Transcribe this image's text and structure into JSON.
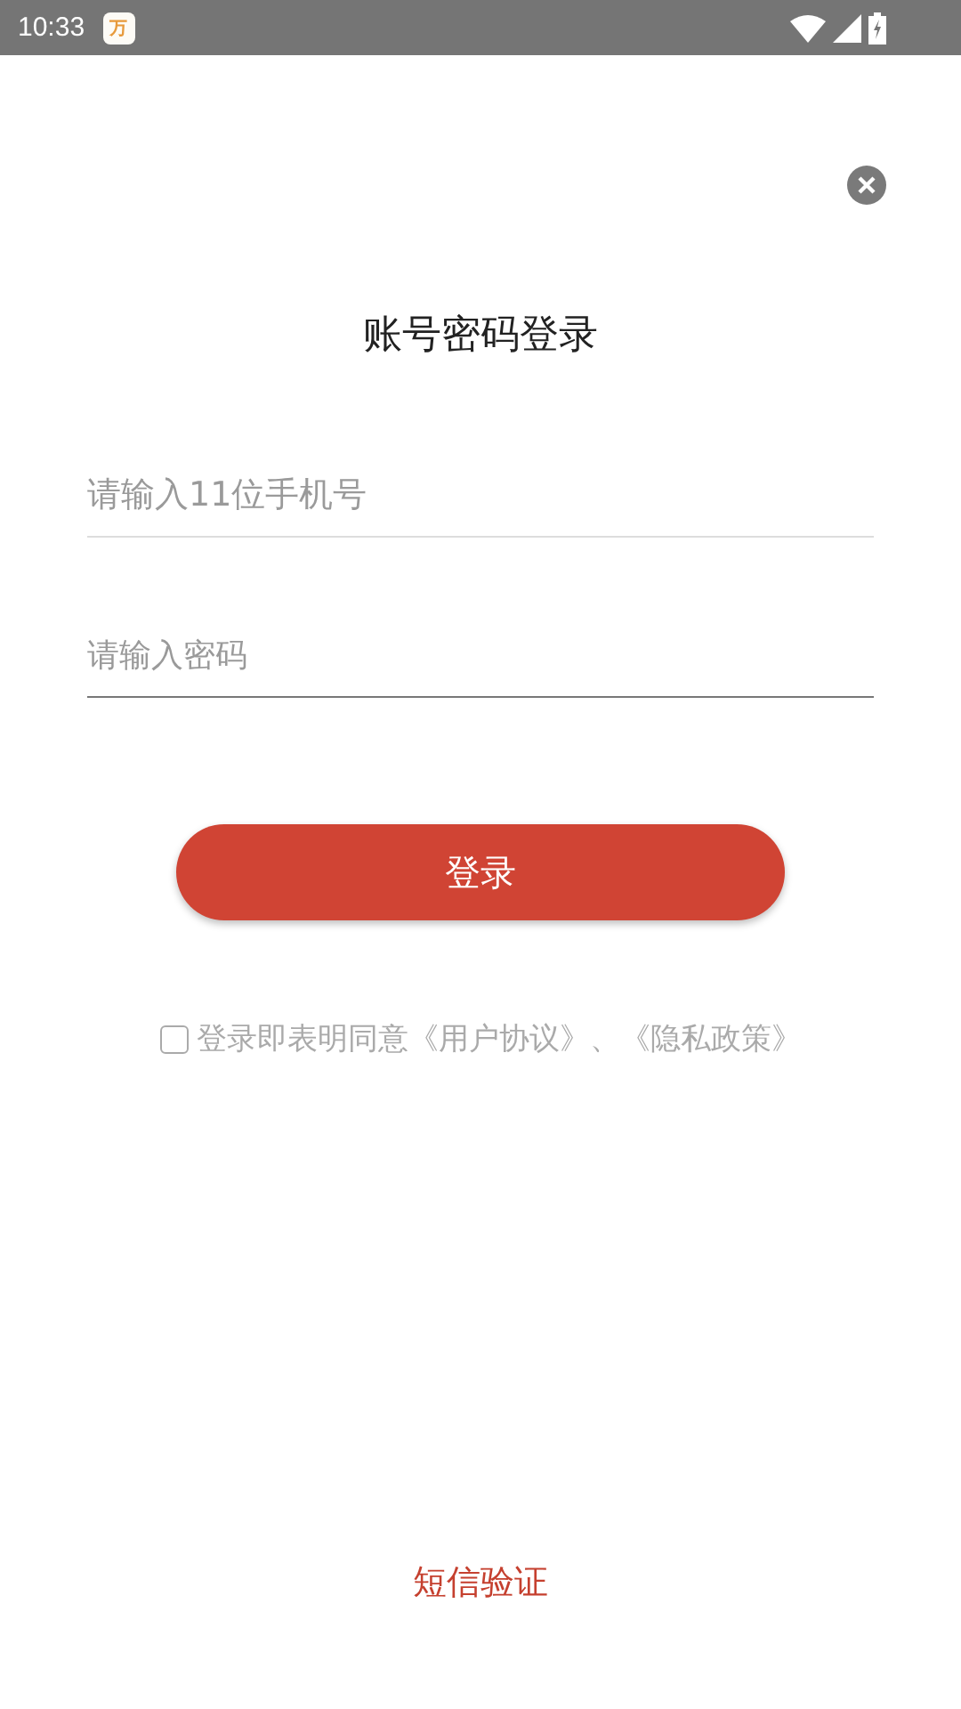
{
  "status_bar": {
    "time": "10:33",
    "app_icon_text": "万"
  },
  "title": "账号密码登录",
  "fields": [
    {
      "placeholder": "请输入11位手机号",
      "focused": false
    },
    {
      "placeholder": "请输入密码",
      "focused": true
    }
  ],
  "login_button": "登录",
  "agreement": {
    "checked": false,
    "text": "登录即表明同意《用户协议》、《隐私政策》"
  },
  "sms_link": "短信验证"
}
